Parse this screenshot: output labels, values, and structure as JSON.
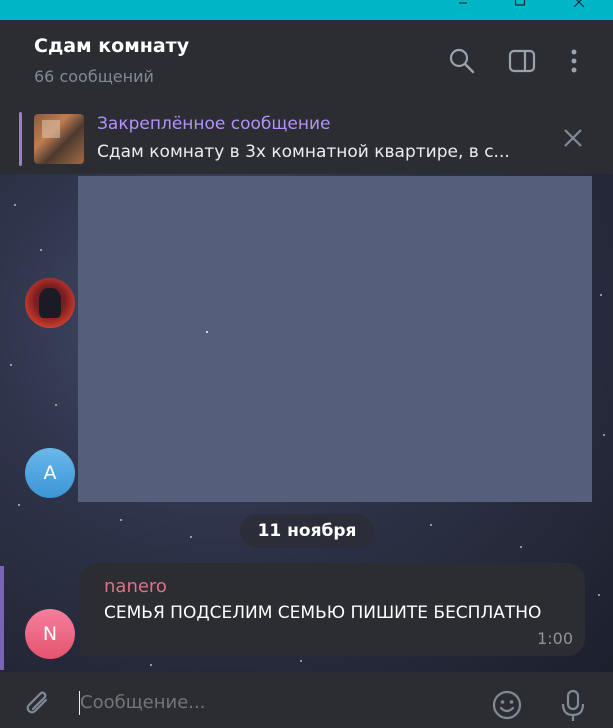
{
  "window": {
    "controls": [
      "minimize",
      "maximize",
      "close"
    ]
  },
  "header": {
    "title": "Сдам комнату",
    "subtitle": "66 сообщений",
    "icons": [
      "search-icon",
      "sidebar-toggle-icon",
      "more-vert-icon"
    ]
  },
  "pinned": {
    "title": "Закреплённое сообщение",
    "text": "Сдам комнату в 3х комнатной квартире, в с...",
    "icon": "close-icon"
  },
  "chat": {
    "date": "11 ноября",
    "avatar_a_initial": "A",
    "message": {
      "sender": "nanero",
      "text": "СЕМЬЯ ПОДСЕЛИМ СЕМЬЮ ПИШИТЕ БЕСПЛАТНО",
      "time": "1:00",
      "avatar_initial": "N"
    }
  },
  "composer": {
    "placeholder": "Сообщение...",
    "icons": [
      "attach-icon",
      "emoji-icon",
      "microphone-icon"
    ]
  },
  "colors": {
    "titlebar": "#00b6c6",
    "panel": "#2b2d33",
    "pinned_accent": "#b491ff",
    "sender_name": "#e56e87"
  }
}
